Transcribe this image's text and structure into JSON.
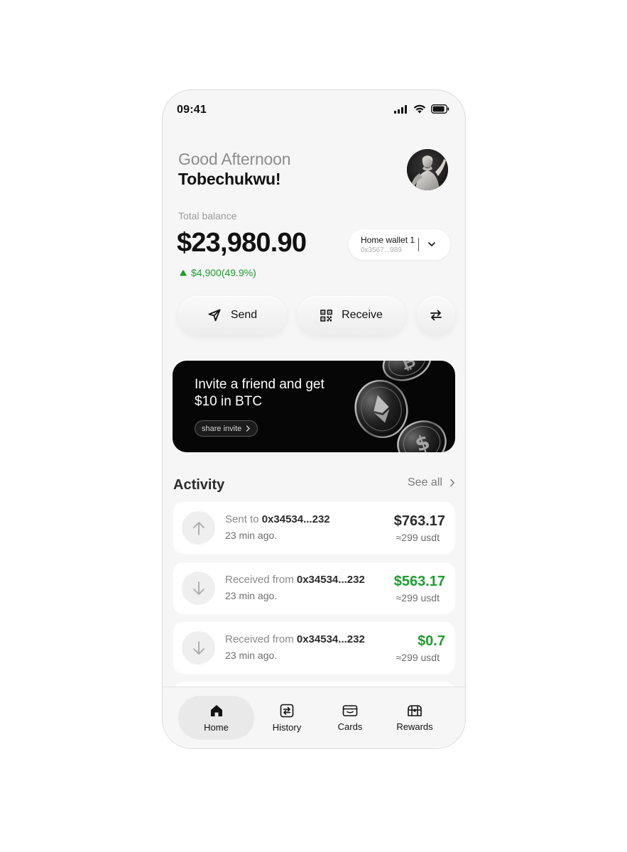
{
  "status_bar": {
    "time": "09:41"
  },
  "header": {
    "greeting": "Good Afternoon",
    "name": "Tobechukwu!"
  },
  "balance": {
    "label": "Total balance",
    "amount": "$23,980.90",
    "change": "$4,900(49.9%)"
  },
  "wallet": {
    "name": "Home wallet 1",
    "address": "0x3567...989"
  },
  "actions": {
    "send": "Send",
    "receive": "Receive"
  },
  "banner": {
    "title": "Invite a friend and get $10 in BTC",
    "button": "share invite"
  },
  "activity": {
    "title": "Activity",
    "see_all": "See all",
    "items": [
      {
        "direction": "sent",
        "prefix": "Sent to ",
        "address": "0x34534...232",
        "time": "23 min ago.",
        "amount": "$763.17",
        "usdt": "≈299 usdt"
      },
      {
        "direction": "received",
        "prefix": "Received from ",
        "address": "0x34534...232",
        "time": "23 min ago.",
        "amount": "$563.17",
        "usdt": "≈299 usdt"
      },
      {
        "direction": "received",
        "prefix": "Received from ",
        "address": "0x34534...232",
        "time": "23 min ago.",
        "amount": "$0.7",
        "usdt": "≈299 usdt"
      }
    ]
  },
  "tabbar": {
    "home": "Home",
    "history": "History",
    "cards": "Cards",
    "rewards": "Rewards"
  },
  "colors": {
    "positive": "#1e9d2f",
    "background": "#f6f6f6",
    "banner": "#060606"
  }
}
